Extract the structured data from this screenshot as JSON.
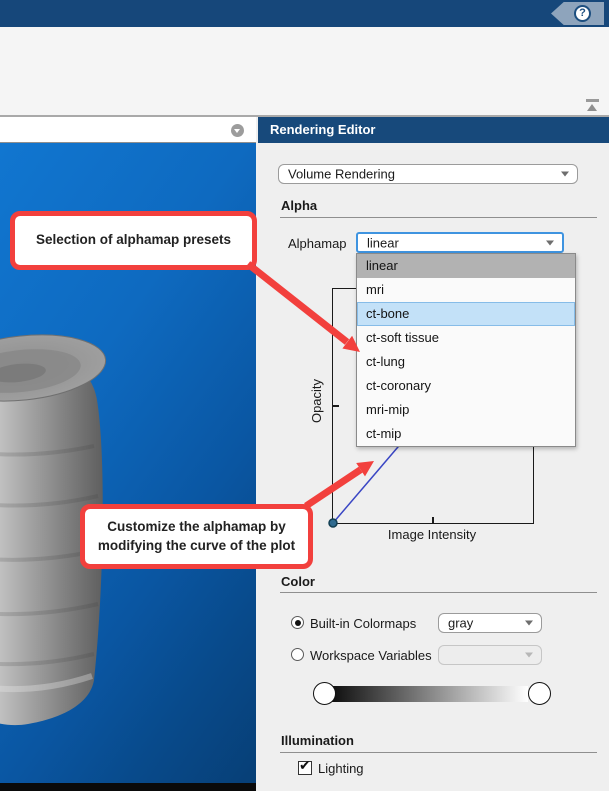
{
  "titlebar": {
    "help_label": "?"
  },
  "editor": {
    "title": "Rendering Editor",
    "mode_value": "Volume Rendering",
    "alpha": {
      "title": "Alpha",
      "alphamap_label": "Alphamap",
      "combo_value": "linear",
      "options": [
        {
          "label": "linear",
          "state": "selected"
        },
        {
          "label": "mri",
          "state": "normal"
        },
        {
          "label": "ct-bone",
          "state": "highlighted"
        },
        {
          "label": "ct-soft tissue",
          "state": "normal"
        },
        {
          "label": "ct-lung",
          "state": "normal"
        },
        {
          "label": "ct-coronary",
          "state": "normal"
        },
        {
          "label": "mri-mip",
          "state": "normal"
        },
        {
          "label": "ct-mip",
          "state": "normal"
        }
      ],
      "plot": {
        "ylabel": "Opacity",
        "xlabel": "Image Intensity",
        "curve": [
          [
            0,
            0
          ],
          [
            1,
            1
          ]
        ],
        "marker_point": [
          0,
          0
        ]
      }
    },
    "color": {
      "title": "Color",
      "builtin_label": "Built-in Colormaps",
      "builtin_selected": true,
      "builtin_value": "gray",
      "workspace_label": "Workspace Variables",
      "workspace_selected": false,
      "workspace_value": "",
      "gradient": [
        "#000000",
        "#ffffff"
      ]
    },
    "illumination": {
      "title": "Illumination",
      "lighting_label": "Lighting",
      "lighting_checked": true
    }
  },
  "callouts": {
    "presets_text": "Selection of alphamap presets",
    "customize_line1": "Customize the alphamap by",
    "customize_line2": "modifying the curve of the plot"
  },
  "colors": {
    "header_blue": "#17497b",
    "callout_red": "#f2403d",
    "curve_blue": "#3a46c4",
    "option_selected_bg": "#b2b2b2",
    "option_hover_bg": "#c3e1f8",
    "viewer_top": "#1176d0",
    "viewer_bottom": "#073f76"
  }
}
